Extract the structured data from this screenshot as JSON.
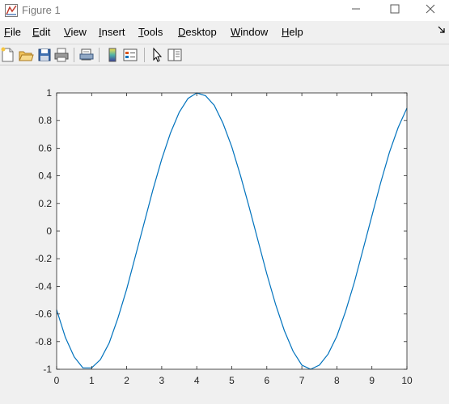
{
  "window": {
    "title": "Figure 1",
    "minimize_icon": "minimize-icon",
    "maximize_icon": "maximize-icon",
    "close_icon": "close-icon"
  },
  "menu": [
    {
      "label": "File",
      "accelerator": "F"
    },
    {
      "label": "Edit",
      "accelerator": "E"
    },
    {
      "label": "View",
      "accelerator": "V"
    },
    {
      "label": "Insert",
      "accelerator": "I"
    },
    {
      "label": "Tools",
      "accelerator": "T"
    },
    {
      "label": "Desktop",
      "accelerator": "D"
    },
    {
      "label": "Window",
      "accelerator": "W"
    },
    {
      "label": "Help",
      "accelerator": "H"
    }
  ],
  "toolbar": [
    "new-figure-icon",
    "open-file-icon",
    "save-icon",
    "print-icon",
    "print-preview-icon",
    "colorbar-icon",
    "legend-icon",
    "pointer-icon",
    "property-inspector-icon"
  ],
  "colors": {
    "line": "#0072bd",
    "axes_background": "#ffffff",
    "figure_background": "#f0f0f0",
    "axis_color": "#262626"
  },
  "chart_data": {
    "type": "line",
    "title": "",
    "xlabel": "",
    "ylabel": "",
    "xlim": [
      0,
      10
    ],
    "ylim": [
      -1,
      1
    ],
    "grid": false,
    "xticks": [
      "0",
      "1",
      "2",
      "3",
      "4",
      "5",
      "6",
      "7",
      "8",
      "9",
      "10"
    ],
    "yticks": [
      "-1",
      "-0.8",
      "-0.6",
      "-0.4",
      "-0.2",
      "0",
      "0.2",
      "0.4",
      "0.6",
      "0.8",
      "1"
    ],
    "series": [
      {
        "x": [
          0,
          0.25,
          0.5,
          0.75,
          1.0,
          1.25,
          1.5,
          1.75,
          2.0,
          2.25,
          2.5,
          2.75,
          3.0,
          3.25,
          3.5,
          3.75,
          4.0,
          4.25,
          4.5,
          4.75,
          5.0,
          5.25,
          5.5,
          5.75,
          6.0,
          6.25,
          6.5,
          6.75,
          7.0,
          7.25,
          7.5,
          7.75,
          8.0,
          8.25,
          8.5,
          8.75,
          9.0,
          9.25,
          9.5,
          9.75,
          10.0
        ],
        "y": [
          -0.57,
          -0.77,
          -0.91,
          -0.99,
          -0.99,
          -0.93,
          -0.81,
          -0.63,
          -0.42,
          -0.18,
          0.06,
          0.3,
          0.52,
          0.71,
          0.86,
          0.96,
          1.0,
          0.98,
          0.91,
          0.78,
          0.61,
          0.4,
          0.17,
          -0.07,
          -0.31,
          -0.53,
          -0.72,
          -0.87,
          -0.97,
          -1.0,
          -0.97,
          -0.89,
          -0.76,
          -0.58,
          -0.37,
          -0.13,
          0.11,
          0.35,
          0.57,
          0.75,
          0.89
        ]
      }
    ]
  }
}
